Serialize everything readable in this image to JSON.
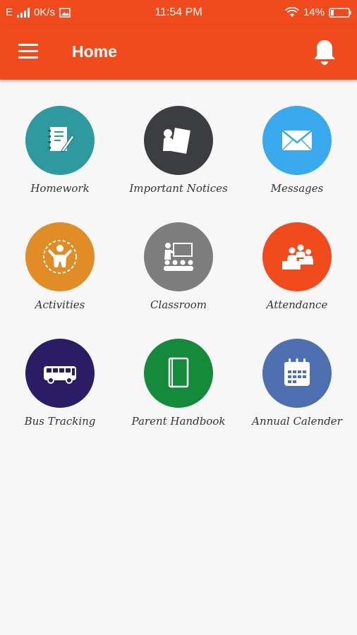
{
  "status_bar": {
    "network": "E",
    "speed": "0K/s",
    "time": "11:54 PM",
    "battery": "14%"
  },
  "header": {
    "title": "Home",
    "menu_icon": "hamburger-menu-icon",
    "notification_icon": "bell-icon"
  },
  "colors": {
    "primary": "#f14a1d",
    "homework": "#2e9aa0",
    "notices": "#3b3d40",
    "messages": "#3aa8ec",
    "activities": "#e08c27",
    "classroom": "#7d7d7d",
    "attendance": "#f14a1d",
    "bus": "#2b1c66",
    "handbook": "#148a3b",
    "calendar": "#4e6fb0"
  },
  "tiles": [
    {
      "label": "Homework",
      "icon": "homework-notebook-icon"
    },
    {
      "label": "Important Notices",
      "icon": "notice-board-icon"
    },
    {
      "label": "Messages",
      "icon": "envelope-icon"
    },
    {
      "label": "Activities",
      "icon": "activity-person-icon"
    },
    {
      "label": "Classroom",
      "icon": "classroom-teacher-icon"
    },
    {
      "label": "Attendance",
      "icon": "attendance-students-icon"
    },
    {
      "label": "Bus Tracking",
      "icon": "bus-icon"
    },
    {
      "label": "Parent Handbook",
      "icon": "book-icon"
    },
    {
      "label": "Annual Calender",
      "icon": "calendar-icon"
    }
  ]
}
